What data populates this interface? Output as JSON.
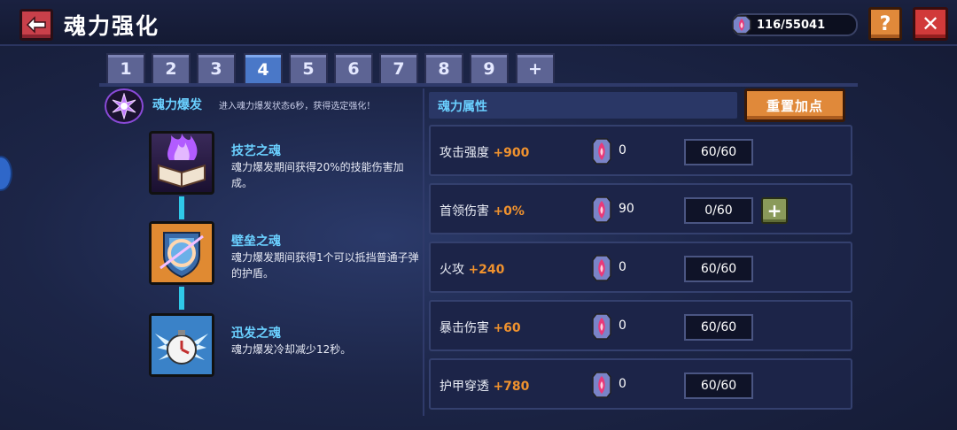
{
  "header": {
    "title": "魂力强化",
    "currency_value": "116/55041",
    "help_label": "?",
    "close_label": "✕"
  },
  "tabs": [
    "1",
    "2",
    "3",
    "4",
    "5",
    "6",
    "7",
    "8",
    "9",
    "+"
  ],
  "active_tab": "4",
  "burst": {
    "title": "魂力爆发",
    "desc": "进入魂力爆发状态6秒，获得选定强化！"
  },
  "skills": [
    {
      "name": "技艺之魂",
      "desc": "魂力爆发期间获得20%的技能伤害加成。"
    },
    {
      "name": "壁垒之魂",
      "desc": "魂力爆发期间获得1个可以抵挡普通子弹的护盾。"
    },
    {
      "name": "迅发之魂",
      "desc": "魂力爆发冷却减少12秒。"
    }
  ],
  "attributes": {
    "header": "魂力属性",
    "reset_label": "重置加点",
    "rows": [
      {
        "name": "攻击强度",
        "bonus": "+900",
        "gems": "0",
        "level": "60/60"
      },
      {
        "name": "首领伤害",
        "bonus": "+0%",
        "gems": "90",
        "level": "0/60",
        "plus": "+"
      },
      {
        "name": "火攻",
        "bonus": "+240",
        "gems": "0",
        "level": "60/60"
      },
      {
        "name": "暴击伤害",
        "bonus": "+60",
        "gems": "0",
        "level": "60/60"
      },
      {
        "name": "护甲穿透",
        "bonus": "+780",
        "gems": "0",
        "level": "60/60"
      }
    ]
  },
  "colors": {
    "accent_blue": "#6ad0ff",
    "bonus_orange": "#f0922e",
    "button_orange": "#e0893a",
    "close_red": "#d13a3a"
  }
}
